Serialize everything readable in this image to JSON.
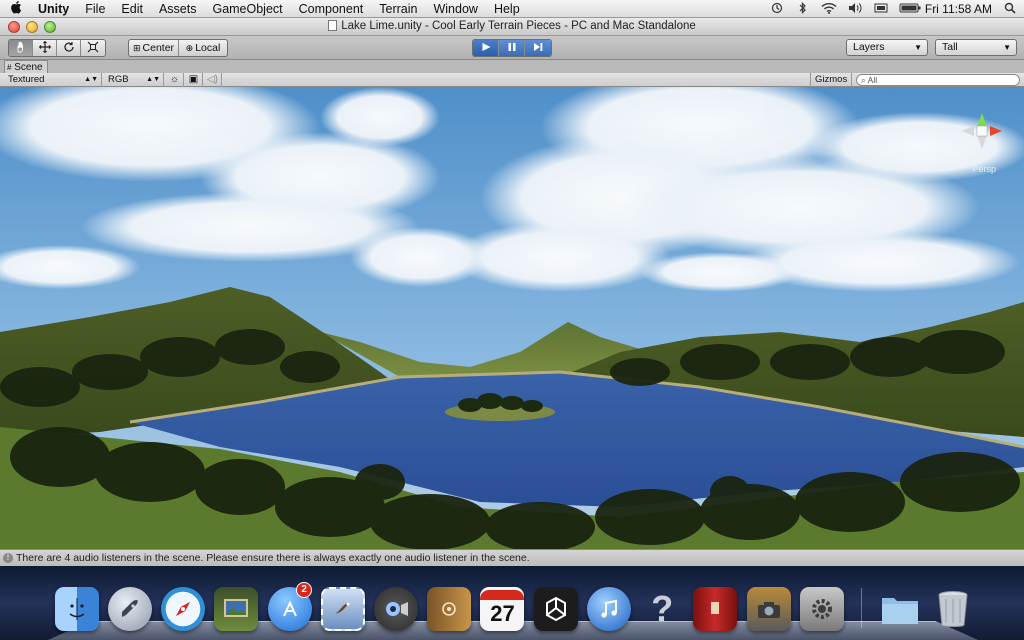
{
  "menubar": {
    "apple": "",
    "items": [
      "Unity",
      "File",
      "Edit",
      "Assets",
      "GameObject",
      "Component",
      "Terrain",
      "Window",
      "Help"
    ],
    "clock": "Fri 11:58 AM",
    "status_icons": [
      "time-machine-icon",
      "bluetooth-icon",
      "wifi-icon",
      "volume-icon",
      "keyboard-icon",
      "battery-icon",
      "spotlight-icon"
    ]
  },
  "window": {
    "title": "Lake Lime.unity - Cool Early Terrain Pieces - PC and Mac Standalone"
  },
  "toolbar": {
    "pivot_label": "Center",
    "space_label": "Local",
    "layers_label": "Layers",
    "layout_label": "Tall"
  },
  "scene": {
    "tab_label": "Scene",
    "shading_mode": "Textured",
    "render_mode": "RGB",
    "gizmos_label": "Gizmos",
    "search_placeholder": "All",
    "view_label": "Persp"
  },
  "console": {
    "message": "There are 4 audio listeners in the scene. Please ensure there is always exactly one audio listener in the scene."
  },
  "dock": {
    "items": [
      {
        "name": "finder",
        "icon": "finder-icon",
        "color": "#3b7fd1"
      },
      {
        "name": "launchpad",
        "icon": "rocket-icon",
        "color": "#9aa6b8"
      },
      {
        "name": "safari",
        "icon": "compass-icon",
        "color": "#2f8fd8"
      },
      {
        "name": "iphoto",
        "icon": "photo-icon",
        "color": "#5a6f3a"
      },
      {
        "name": "app-store",
        "icon": "app-store-icon",
        "color": "#2a7fe0",
        "badge": "2"
      },
      {
        "name": "mail",
        "icon": "stamp-icon",
        "color": "#6c8ebf"
      },
      {
        "name": "facetime",
        "icon": "camera-icon",
        "color": "#4a4a4a"
      },
      {
        "name": "address-book",
        "icon": "book-icon",
        "color": "#a67a3c"
      },
      {
        "name": "ical",
        "icon": "calendar-icon",
        "color": "#f2f2f2",
        "label": "27"
      },
      {
        "name": "unity",
        "icon": "unity-icon",
        "color": "#222222"
      },
      {
        "name": "itunes",
        "icon": "music-icon",
        "color": "#2a6fd0"
      },
      {
        "name": "help",
        "icon": "question-icon",
        "color": "#6a6a7a"
      },
      {
        "name": "photo-booth",
        "icon": "curtain-icon",
        "color": "#a31e1e"
      },
      {
        "name": "image-capture",
        "icon": "camera-photos-icon",
        "color": "#5a5a5a"
      },
      {
        "name": "system-preferences",
        "icon": "gear-icon",
        "color": "#7d7d7d"
      },
      {
        "name": "downloads",
        "icon": "folder-icon",
        "color": "#7fb3e0"
      },
      {
        "name": "trash",
        "icon": "trash-icon",
        "color": "#bfc5cc"
      }
    ]
  }
}
